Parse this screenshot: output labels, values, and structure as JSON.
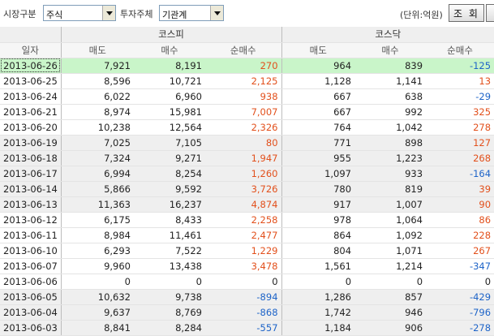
{
  "toolbar": {
    "market_label": "시장구분",
    "market_value": "주식",
    "investor_label": "투자주체",
    "investor_value": "기관계",
    "unit_label": "(단위:억원)",
    "search_button": "조 회"
  },
  "table": {
    "date_header": "일자",
    "group_kospi": "코스피",
    "group_kosdaq": "코스닥",
    "col_sell": "매도",
    "col_buy": "매수",
    "col_net": "순매수",
    "rows": [
      {
        "date": "2013-06-26",
        "kospi_sell": "7,921",
        "kospi_buy": "8,191",
        "kospi_net": "270",
        "kosdaq_sell": "964",
        "kosdaq_buy": "839",
        "kosdaq_net": "-125"
      },
      {
        "date": "2013-06-25",
        "kospi_sell": "8,596",
        "kospi_buy": "10,721",
        "kospi_net": "2,125",
        "kosdaq_sell": "1,128",
        "kosdaq_buy": "1,141",
        "kosdaq_net": "13"
      },
      {
        "date": "2013-06-24",
        "kospi_sell": "6,022",
        "kospi_buy": "6,960",
        "kospi_net": "938",
        "kosdaq_sell": "667",
        "kosdaq_buy": "638",
        "kosdaq_net": "-29"
      },
      {
        "date": "2013-06-21",
        "kospi_sell": "8,974",
        "kospi_buy": "15,981",
        "kospi_net": "7,007",
        "kosdaq_sell": "667",
        "kosdaq_buy": "992",
        "kosdaq_net": "325"
      },
      {
        "date": "2013-06-20",
        "kospi_sell": "10,238",
        "kospi_buy": "12,564",
        "kospi_net": "2,326",
        "kosdaq_sell": "764",
        "kosdaq_buy": "1,042",
        "kosdaq_net": "278"
      },
      {
        "date": "2013-06-19",
        "kospi_sell": "7,025",
        "kospi_buy": "7,105",
        "kospi_net": "80",
        "kosdaq_sell": "771",
        "kosdaq_buy": "898",
        "kosdaq_net": "127"
      },
      {
        "date": "2013-06-18",
        "kospi_sell": "7,324",
        "kospi_buy": "9,271",
        "kospi_net": "1,947",
        "kosdaq_sell": "955",
        "kosdaq_buy": "1,223",
        "kosdaq_net": "268"
      },
      {
        "date": "2013-06-17",
        "kospi_sell": "6,994",
        "kospi_buy": "8,254",
        "kospi_net": "1,260",
        "kosdaq_sell": "1,097",
        "kosdaq_buy": "933",
        "kosdaq_net": "-164"
      },
      {
        "date": "2013-06-14",
        "kospi_sell": "5,866",
        "kospi_buy": "9,592",
        "kospi_net": "3,726",
        "kosdaq_sell": "780",
        "kosdaq_buy": "819",
        "kosdaq_net": "39"
      },
      {
        "date": "2013-06-13",
        "kospi_sell": "11,363",
        "kospi_buy": "16,237",
        "kospi_net": "4,874",
        "kosdaq_sell": "917",
        "kosdaq_buy": "1,007",
        "kosdaq_net": "90"
      },
      {
        "date": "2013-06-12",
        "kospi_sell": "6,175",
        "kospi_buy": "8,433",
        "kospi_net": "2,258",
        "kosdaq_sell": "978",
        "kosdaq_buy": "1,064",
        "kosdaq_net": "86"
      },
      {
        "date": "2013-06-11",
        "kospi_sell": "8,984",
        "kospi_buy": "11,461",
        "kospi_net": "2,477",
        "kosdaq_sell": "864",
        "kosdaq_buy": "1,092",
        "kosdaq_net": "228"
      },
      {
        "date": "2013-06-10",
        "kospi_sell": "6,293",
        "kospi_buy": "7,522",
        "kospi_net": "1,229",
        "kosdaq_sell": "804",
        "kosdaq_buy": "1,071",
        "kosdaq_net": "267"
      },
      {
        "date": "2013-06-07",
        "kospi_sell": "9,960",
        "kospi_buy": "13,438",
        "kospi_net": "3,478",
        "kosdaq_sell": "1,561",
        "kosdaq_buy": "1,214",
        "kosdaq_net": "-347"
      },
      {
        "date": "2013-06-06",
        "kospi_sell": "0",
        "kospi_buy": "0",
        "kospi_net": "0",
        "kosdaq_sell": "0",
        "kosdaq_buy": "0",
        "kosdaq_net": "0"
      },
      {
        "date": "2013-06-05",
        "kospi_sell": "10,632",
        "kospi_buy": "9,738",
        "kospi_net": "-894",
        "kosdaq_sell": "1,286",
        "kosdaq_buy": "857",
        "kosdaq_net": "-429"
      },
      {
        "date": "2013-06-04",
        "kospi_sell": "9,637",
        "kospi_buy": "8,769",
        "kospi_net": "-868",
        "kosdaq_sell": "1,742",
        "kosdaq_buy": "946",
        "kosdaq_net": "-796"
      },
      {
        "date": "2013-06-03",
        "kospi_sell": "8,841",
        "kospi_buy": "8,284",
        "kospi_net": "-557",
        "kosdaq_sell": "1,184",
        "kosdaq_buy": "906",
        "kosdaq_net": "-278"
      }
    ]
  },
  "colors": {
    "positive": "#e2501c",
    "negative": "#1e64c8",
    "selected_row": "#c9f5c9",
    "shaded_row": "#efefef"
  }
}
